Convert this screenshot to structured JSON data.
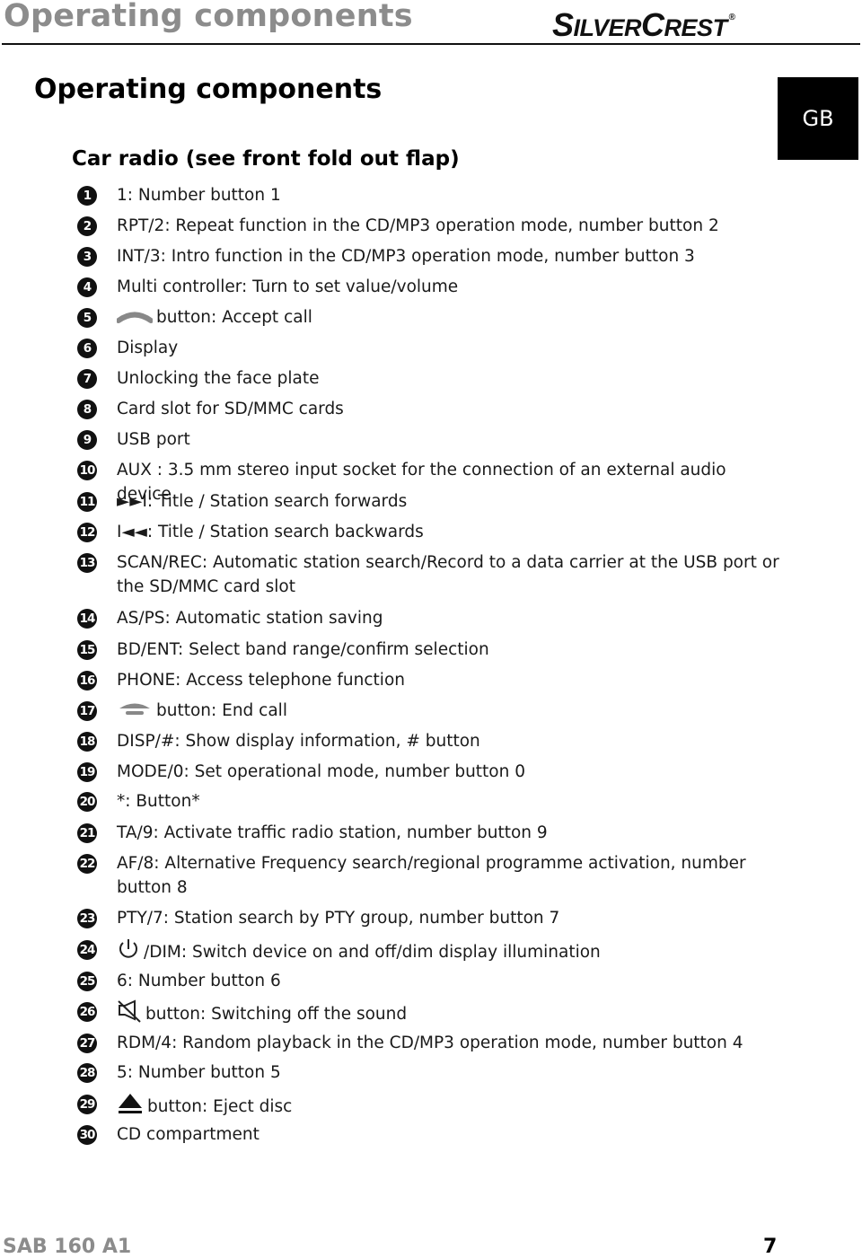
{
  "header": {
    "running_title": "Operating components",
    "brand": {
      "part1_cap": "S",
      "part1_rest": "ILVER",
      "part2_cap": "C",
      "part2_rest": "REST",
      "registered": "®"
    },
    "language_tab": "GB"
  },
  "page_title": "Operating components",
  "section_title": "Car radio (see front fold out flap)",
  "items": [
    {
      "num": "1",
      "text": "1: Number button 1"
    },
    {
      "num": "2",
      "text": "RPT/2: Repeat function in the CD/MP3 operation mode, number button 2"
    },
    {
      "num": "3",
      "text": "INT/3: Intro function in the CD/MP3 operation mode, number button 3"
    },
    {
      "num": "4",
      "text": "Multi controller: Turn to set value/volume"
    },
    {
      "num": "5",
      "icon": "accept-call-icon",
      "text": "button: Accept call"
    },
    {
      "num": "6",
      "text": "Display"
    },
    {
      "num": "7",
      "text": "Unlocking the face plate"
    },
    {
      "num": "8",
      "text": "Card slot for SD/MMC cards"
    },
    {
      "num": "9",
      "text": "USB port"
    },
    {
      "num": "10",
      "text": "AUX : 3.5 mm stereo input socket for the connection of an external audio device"
    },
    {
      "num": "11",
      "text": "►►I: Title / Station search forwards"
    },
    {
      "num": "12",
      "text": "I◄◄: Title / Station search backwards"
    },
    {
      "num": "13",
      "text": "SCAN/REC: Automatic station search/Record to a data carrier at the USB port or the SD/MMC card slot"
    },
    {
      "num": "14",
      "text": "AS/PS: Automatic station saving"
    },
    {
      "num": "15",
      "text": "BD/ENT: Select band range/confirm selection"
    },
    {
      "num": "16",
      "text": "PHONE: Access telephone function"
    },
    {
      "num": "17",
      "icon": "end-call-icon",
      "text": "button: End call"
    },
    {
      "num": "18",
      "text": "DISP/#: Show display information, # button"
    },
    {
      "num": "19",
      "text": "MODE/0: Set operational mode, number button 0"
    },
    {
      "num": "20",
      "text": "*: Button*"
    },
    {
      "num": "21",
      "text": "TA/9: Activate traffic radio station, number button 9"
    },
    {
      "num": "22",
      "text": "AF/8: Alternative Frequency search/regional programme activation, number button 8"
    },
    {
      "num": "23",
      "text": "PTY/7: Station search by PTY group, number button 7"
    },
    {
      "num": "24",
      "icon": "power-icon",
      "text": "/DIM: Switch device on and off/dim display illumination"
    },
    {
      "num": "25",
      "text": "6: Number button 6"
    },
    {
      "num": "26",
      "icon": "mute-icon",
      "text": "button: Switching off the sound"
    },
    {
      "num": "27",
      "text": "RDM/4: Random playback in the CD/MP3 operation mode, number button 4"
    },
    {
      "num": "28",
      "text": "5: Number button 5"
    },
    {
      "num": "29",
      "icon": "eject-icon",
      "text": "button: Eject disc"
    },
    {
      "num": "30",
      "text": "CD compartment"
    }
  ],
  "footer": {
    "model": "SAB 160 A1",
    "page_number": "7"
  }
}
